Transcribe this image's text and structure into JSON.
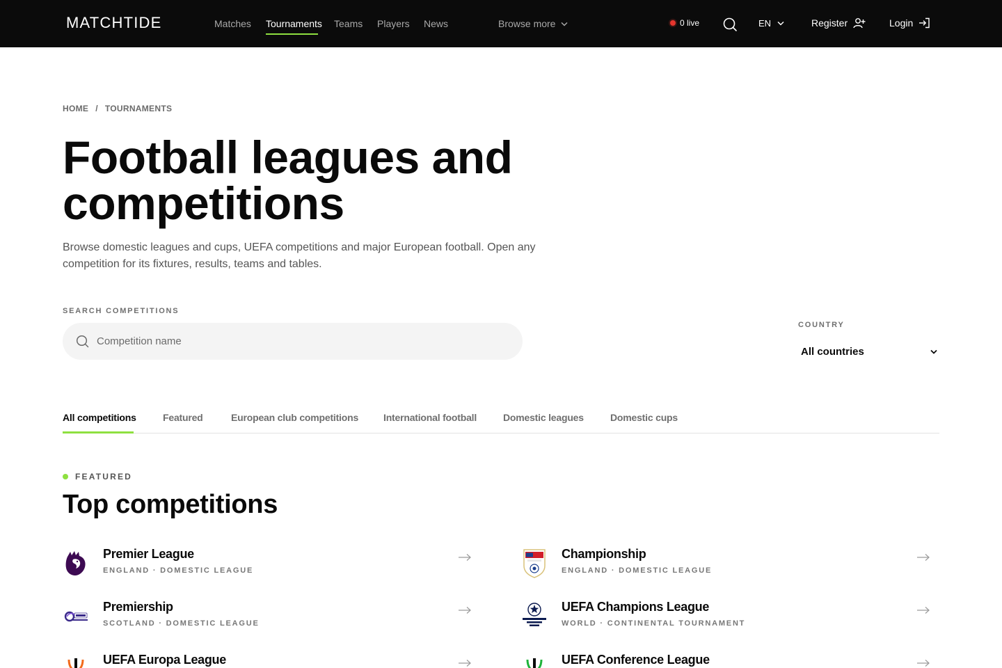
{
  "brand": {
    "logo_text": "MATCHTIDE"
  },
  "nav": {
    "links": [
      "Matches",
      "Tournaments",
      "Teams",
      "Players",
      "News"
    ],
    "active": "Tournaments",
    "browse_more": "Browse more",
    "live_count": "0 live",
    "language": "EN",
    "register": "Register",
    "login": "Login"
  },
  "breadcrumb": {
    "home": "HOME",
    "sep": "/",
    "current": "TOURNAMENTS"
  },
  "hero": {
    "title": "Football leagues and competitions",
    "lead": "Browse domestic leagues and cups, UEFA competitions and major European football. Open any competition for its fixtures, results, teams and tables."
  },
  "filters": {
    "search_label": "SEARCH COMPETITIONS",
    "search_placeholder": "Competition name",
    "search_value": "",
    "country_label": "COUNTRY",
    "country_value": "All countries"
  },
  "tabs": [
    {
      "label": "All competitions",
      "active": true
    },
    {
      "label": "Featured",
      "active": false
    },
    {
      "label": "European club competitions",
      "active": false
    },
    {
      "label": "International football",
      "active": false
    },
    {
      "label": "Domestic leagues",
      "active": false
    },
    {
      "label": "Domestic cups",
      "active": false
    }
  ],
  "featured": {
    "tag": "FEATURED",
    "title": "Top competitions",
    "items": [
      {
        "name": "Premier League",
        "meta": "ENGLAND · DOMESTIC LEAGUE",
        "icon": "premier-league-lion-icon"
      },
      {
        "name": "Championship",
        "meta": "ENGLAND · DOMESTIC LEAGUE",
        "icon": "efl-championship-shield-icon"
      },
      {
        "name": "Premiership",
        "meta": "SCOTLAND · DOMESTIC LEAGUE",
        "icon": "cinch-premiership-icon"
      },
      {
        "name": "UEFA Champions League",
        "meta": "WORLD · CONTINENTAL TOURNAMENT",
        "icon": "champions-league-starball-icon"
      },
      {
        "name": "UEFA Europa League",
        "meta": "",
        "icon": "europa-league-trophy-icon"
      },
      {
        "name": "UEFA Conference League",
        "meta": "",
        "icon": "conference-league-trophy-icon"
      }
    ]
  },
  "colors": {
    "accent": "#8ee040",
    "nav_bg": "#0b0b0b",
    "live_dot": "#e5352d"
  }
}
